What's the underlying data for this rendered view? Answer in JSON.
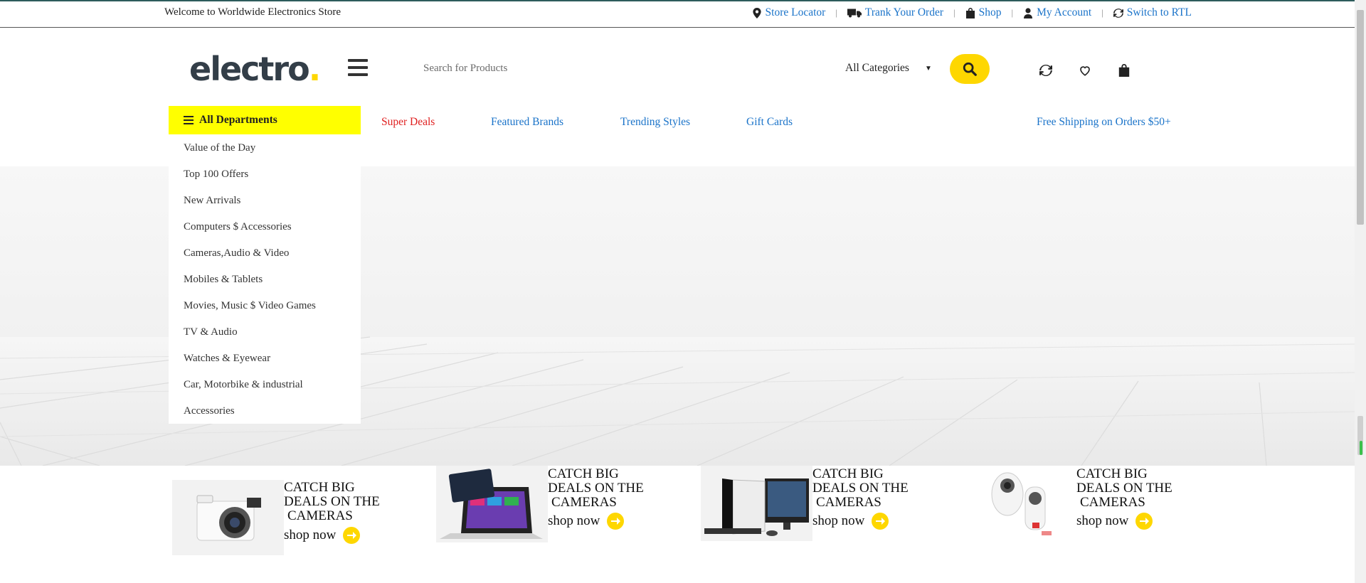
{
  "topbar": {
    "welcome": "Welcome to Worldwide Electronics Store",
    "links": [
      {
        "label": "Store Locator",
        "icon": "map-pin-icon"
      },
      {
        "label": "Trank Your Order",
        "icon": "truck-icon"
      },
      {
        "label": "Shop",
        "icon": "shopping-bag-icon"
      },
      {
        "label": "My Account",
        "icon": "user-icon"
      },
      {
        "label": "Switch to RTL",
        "icon": "refresh-icon"
      }
    ]
  },
  "header": {
    "logo_text": "electro",
    "logo_dot": ".",
    "search_placeholder": "Search for Products",
    "category_select": "All Categories",
    "icons": [
      "compare-icon",
      "heart-icon",
      "cart-icon"
    ]
  },
  "nav": {
    "departments_label": "All Departments",
    "links": [
      "Super Deals",
      "Featured Brands",
      "Trending Styles",
      "Gift Cards"
    ],
    "free_shipping": "Free Shipping on Orders $50+"
  },
  "departments": [
    "Value of the Day",
    "Top 100 Offers",
    "New Arrivals",
    "Computers $ Accessories",
    "Cameras,Audio & Video",
    "Mobiles & Tablets",
    "Movies, Music $ Video Games",
    "TV & Audio",
    "Watches & Eyewear",
    "Car, Motorbike & industrial",
    "Accessories"
  ],
  "promos": [
    {
      "line1": "CATCH BIG",
      "line2": "DEALS ON THE",
      "line3": "CAMERAS",
      "cta": "shop now",
      "image": "camera"
    },
    {
      "line1": "CATCH BIG",
      "line2": "DEALS ON THE",
      "line3": "CAMERAS",
      "cta": "shop now",
      "image": "laptop-tablet"
    },
    {
      "line1": "CATCH BIG",
      "line2": "DEALS ON THE",
      "line3": "CAMERAS",
      "cta": "shop now",
      "image": "desktop-pc"
    },
    {
      "line1": "CATCH BIG",
      "line2": "DEALS ON THE",
      "line3": "CAMERAS",
      "cta": "shop now",
      "image": "360-camera"
    }
  ],
  "colors": {
    "accent_yellow": "#fed700",
    "departments_bg": "#ffff00",
    "link_blue": "#1a73c9",
    "deal_red": "#e02020"
  }
}
